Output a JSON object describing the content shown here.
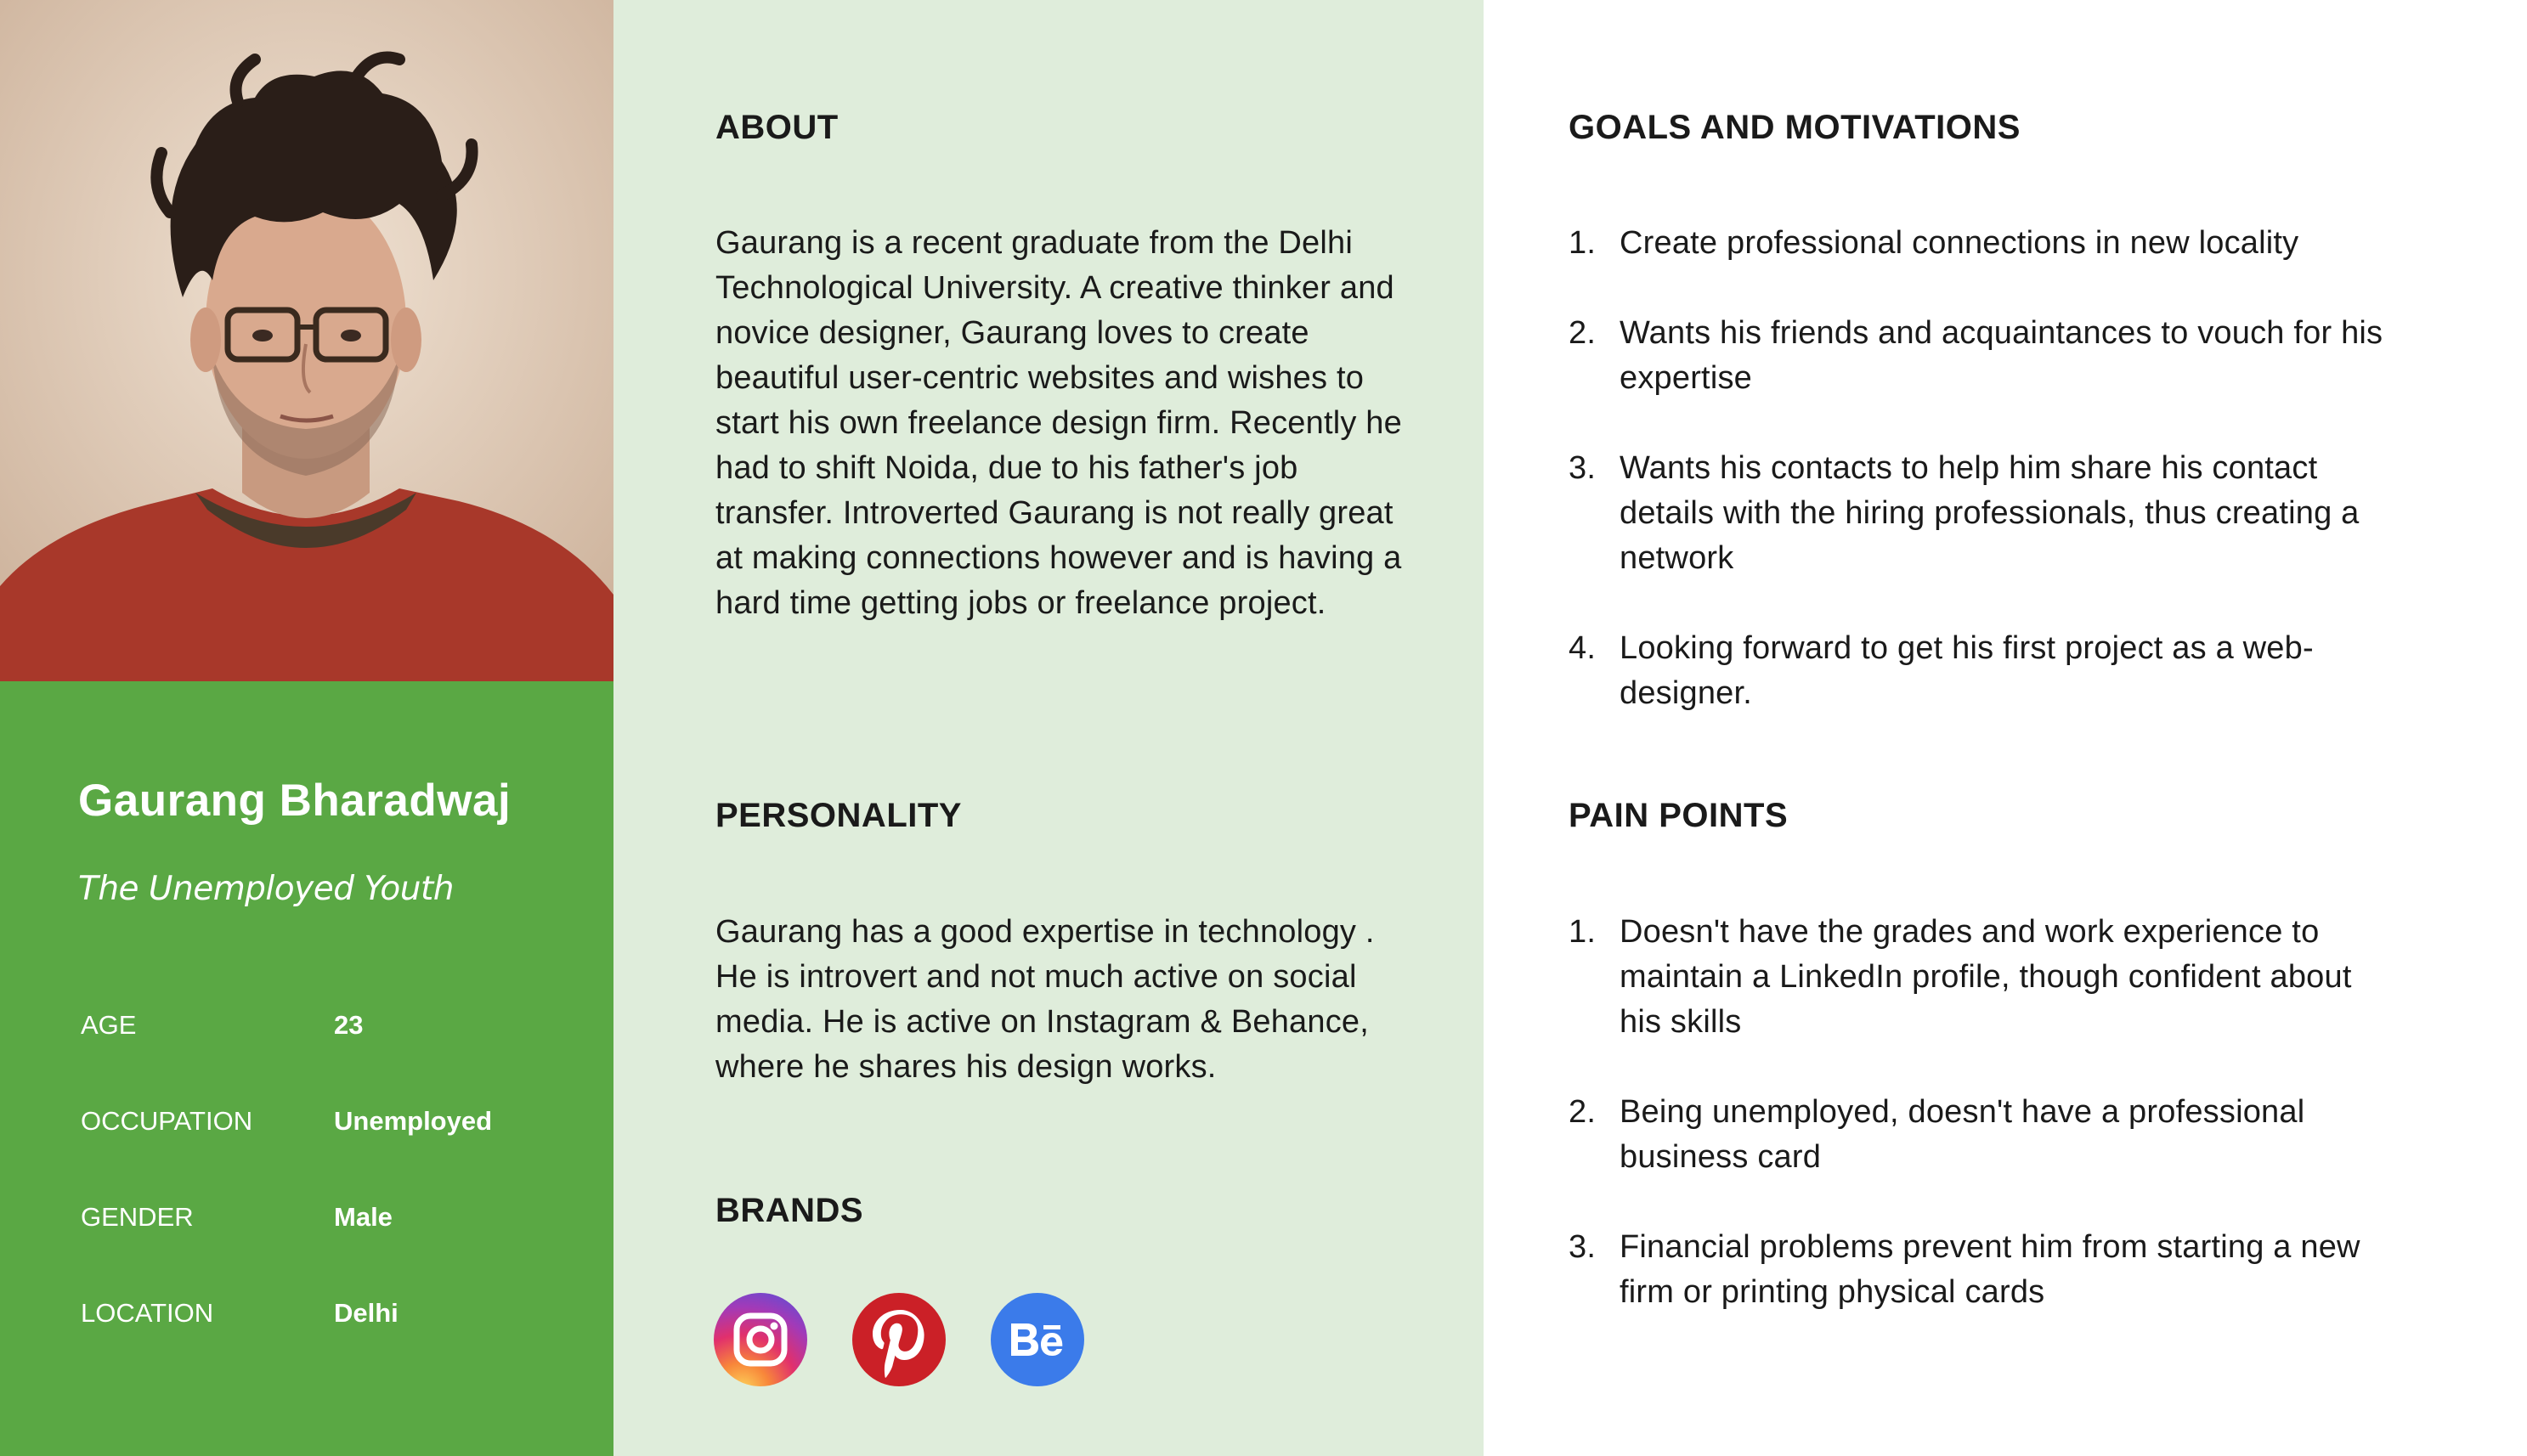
{
  "person": {
    "name": "Gaurang Bharadwaj",
    "tagline": "The Unemployed Youth",
    "stats": [
      {
        "label": "AGE",
        "value": "23"
      },
      {
        "label": "OCCUPATION",
        "value": "Unemployed"
      },
      {
        "label": "GENDER",
        "value": "Male"
      },
      {
        "label": "LOCATION",
        "value": "Delhi"
      }
    ]
  },
  "about": {
    "heading": "ABOUT",
    "text": "Gaurang is a recent  graduate from the Delhi Technological  University. A creative thinker and novice designer, Gaurang loves to create beautiful user-centric websites and wishes to start his own  freelance design firm. Recently he had to shift Noida, due to his father's job transfer.  Introverted  Gaurang is  not  really great at making connections however and is having a hard time getting jobs or freelance project."
  },
  "personality": {
    "heading": "PERSONALITY",
    "text": "Gaurang has a good expertise in technology . He is introvert and not much active on social media. He is active on Instagram & Behance, where he shares his design works."
  },
  "brands": {
    "heading": "BRANDS",
    "icons": [
      "instagram-icon",
      "pinterest-icon",
      "behance-icon"
    ]
  },
  "goals": {
    "heading": "GOALS AND MOTIVATIONS",
    "items": [
      {
        "num": "1.",
        "text": "Create professional connections in new locality"
      },
      {
        "num": "2.",
        "text": "Wants his friends and acquaintances to vouch for his expertise"
      },
      {
        "num": "3.",
        "text": "Wants his contacts to help him share his contact details with the hiring professionals, thus creating a network"
      },
      {
        "num": "4.",
        "text": "Looking forward to get his first project as a web-designer."
      }
    ]
  },
  "pain_points": {
    "heading": "PAIN POINTS",
    "items": [
      {
        "num": "1.",
        "text": "Doesn't have the grades and work experience to maintain a LinkedIn profile, though confident about his skills"
      },
      {
        "num": "2.",
        "text": "Being unemployed, doesn't have a professional business card"
      },
      {
        "num": "3.",
        "text": "Financial problems prevent him from starting a new firm or printing physical cards"
      }
    ]
  },
  "colors": {
    "profile_green": "#5aa844",
    "middle_bg": "#dfeddb",
    "instagram": "#e1306c",
    "pinterest": "#cb2027",
    "behance": "#3b7bea"
  }
}
